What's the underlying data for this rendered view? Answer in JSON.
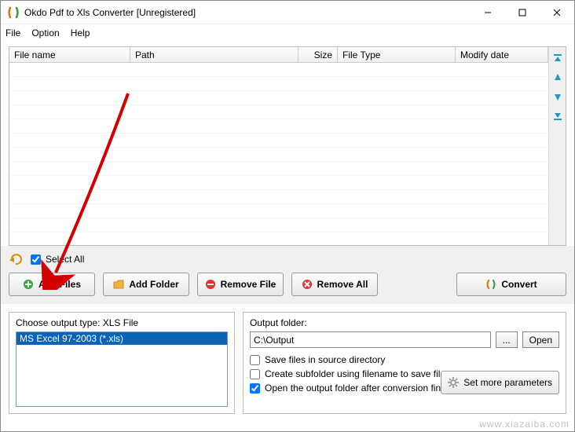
{
  "window": {
    "title": "Okdo Pdf to Xls Converter [Unregistered]"
  },
  "menu": {
    "file": "File",
    "option": "Option",
    "help": "Help"
  },
  "columns": {
    "filename": "File name",
    "path": "Path",
    "size": "Size",
    "filetype": "File Type",
    "modify": "Modify date"
  },
  "selectall": {
    "label": "Select All",
    "checked": true
  },
  "buttons": {
    "addFiles": "Add Files",
    "addFolder": "Add Folder",
    "removeFile": "Remove File",
    "removeAll": "Remove All",
    "convert": "Convert"
  },
  "outputType": {
    "caption": "Choose output type:  XLS File",
    "selected": "MS Excel 97-2003 (*.xls)"
  },
  "outputFolder": {
    "caption": "Output folder:",
    "path": "C:\\Output",
    "browse": "...",
    "open": "Open"
  },
  "options": {
    "saveInSource": {
      "label": "Save files in source directory",
      "checked": false
    },
    "subfolder": {
      "label": "Create subfolder using filename to save files",
      "checked": false
    },
    "openAfter": {
      "label": "Open the output folder after conversion finished",
      "checked": true
    }
  },
  "moreParams": "Set more parameters",
  "watermark": "www.xiazaiba.com"
}
